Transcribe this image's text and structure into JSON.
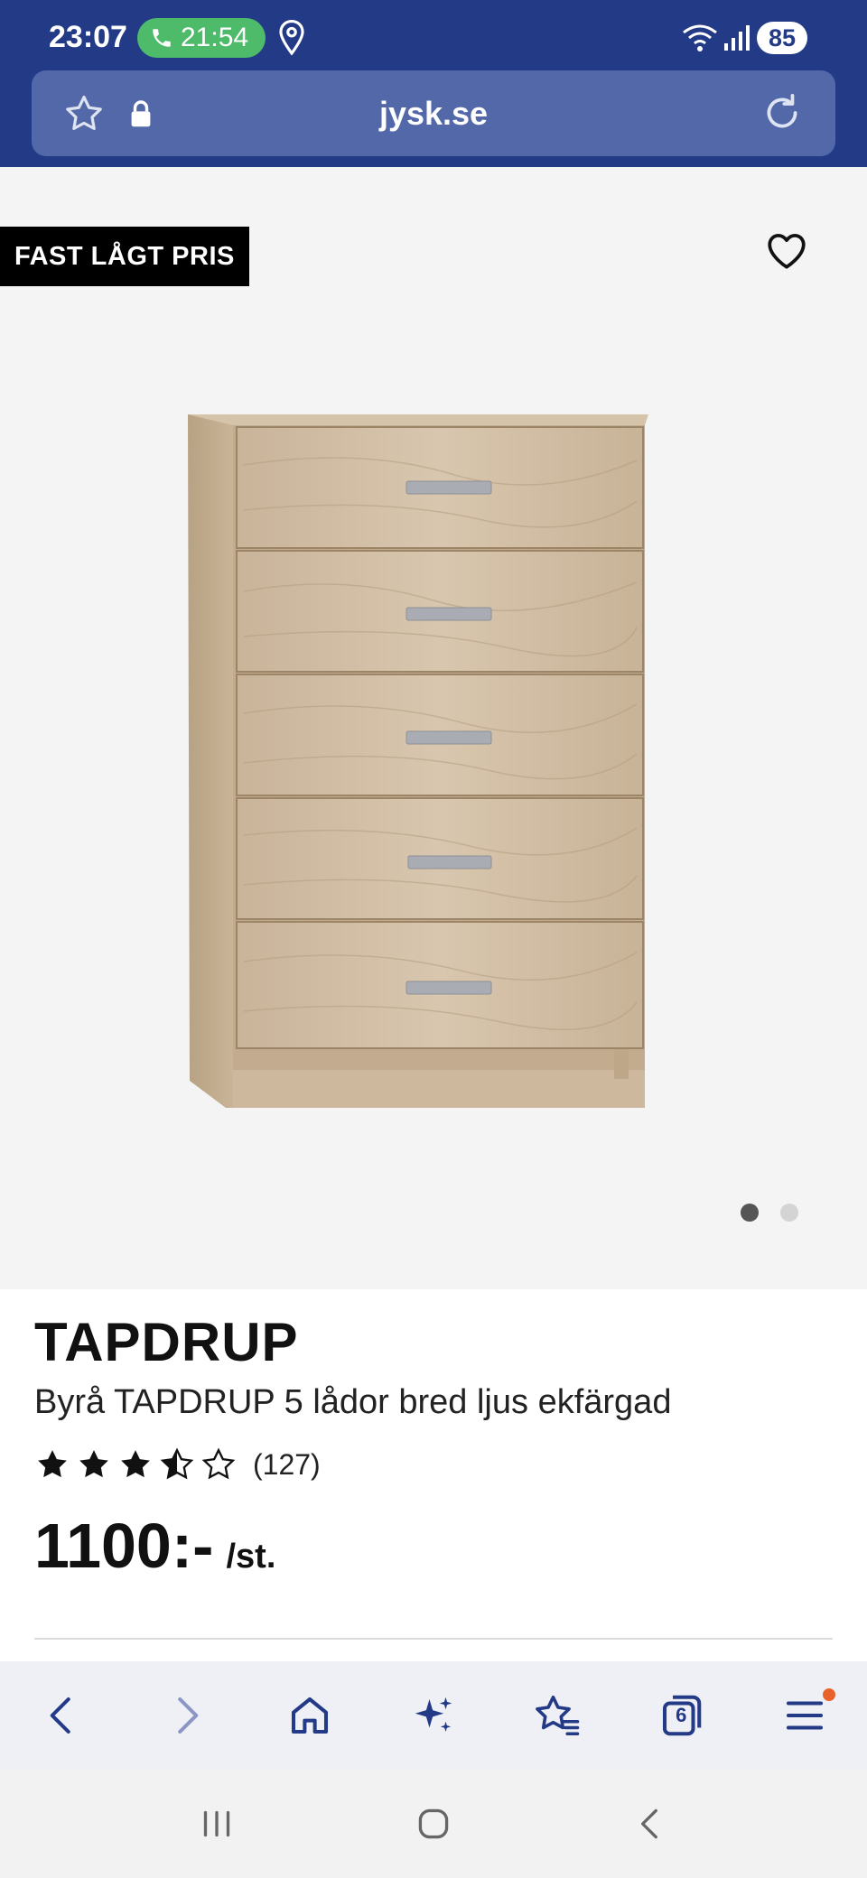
{
  "status_bar": {
    "time": "23:07",
    "call_duration": "21:54",
    "battery": "85"
  },
  "browser": {
    "url": "jysk.se",
    "tab_count": "6"
  },
  "product": {
    "badge": "FAST LÅGT PRIS",
    "brand": "TAPDRUP",
    "description": "Byrå TAPDRUP 5 lådor bred ljus ekfärgad",
    "rating_stars": 3.5,
    "rating_count": "(127)",
    "price": "1100:-",
    "unit": "/st.",
    "image_count": 2,
    "active_image": 1
  },
  "icons": {
    "status": [
      "phone-icon",
      "location-icon",
      "wifi-icon",
      "signal-icon"
    ],
    "url_bar": [
      "star-icon",
      "lock-icon",
      "reload-icon"
    ],
    "toolbar": [
      "back-arrow-icon",
      "forward-arrow-icon",
      "home-icon",
      "sparkle-icon",
      "bookmarks-icon",
      "tabs-icon",
      "menu-icon"
    ],
    "nav": [
      "recents-icon",
      "home-circle-icon",
      "back-icon"
    ]
  },
  "colors": {
    "brand_blue": "#233a86",
    "url_bar_bg": "#5268a8",
    "call_green": "#4dbb6a",
    "badge_bg": "#000000",
    "notification": "#e8622a"
  }
}
